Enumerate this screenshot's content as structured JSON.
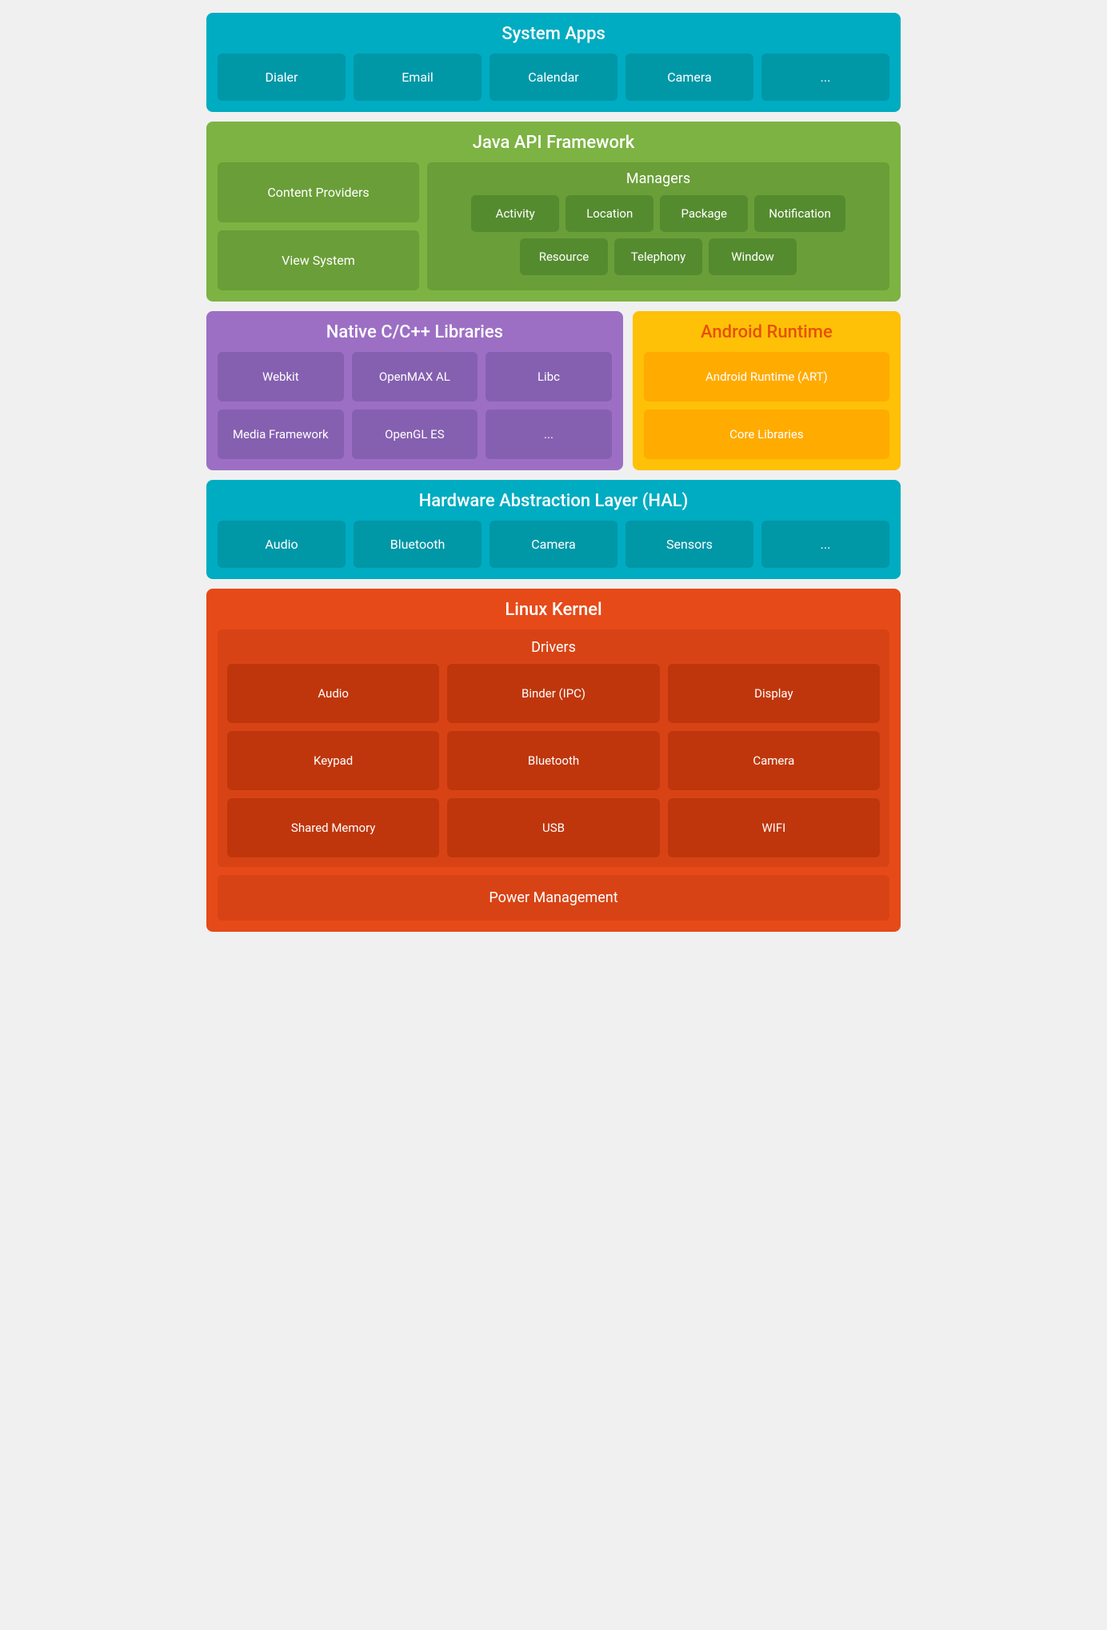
{
  "systemApps": {
    "title": "System Apps",
    "items": [
      "Dialer",
      "Email",
      "Calendar",
      "Camera",
      "..."
    ]
  },
  "javaApi": {
    "title": "Java API Framework",
    "leftItems": [
      "Content Providers",
      "View System"
    ],
    "managers": {
      "title": "Managers",
      "row1": [
        "Activity",
        "Location",
        "Package",
        "Notification"
      ],
      "row2": [
        "Resource",
        "Telephony",
        "Window"
      ]
    }
  },
  "nativeLibs": {
    "title": "Native C/C++ Libraries",
    "items": [
      "Webkit",
      "OpenMAX AL",
      "Libc",
      "Media Framework",
      "OpenGL ES",
      "..."
    ]
  },
  "androidRuntime": {
    "title": "Android Runtime",
    "items": [
      "Android Runtime (ART)",
      "Core Libraries"
    ]
  },
  "hal": {
    "title": "Hardware Abstraction Layer (HAL)",
    "items": [
      "Audio",
      "Bluetooth",
      "Camera",
      "Sensors",
      "..."
    ]
  },
  "linuxKernel": {
    "title": "Linux Kernel",
    "driversTitle": "Drivers",
    "drivers": [
      "Audio",
      "Binder (IPC)",
      "Display",
      "Keypad",
      "Bluetooth",
      "Camera",
      "Shared Memory",
      "USB",
      "WIFI"
    ],
    "powerManagement": "Power Management"
  }
}
